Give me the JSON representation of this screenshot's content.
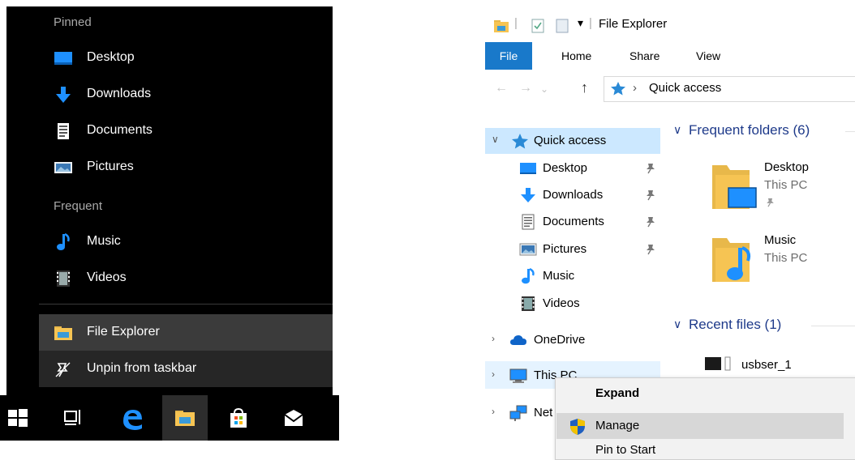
{
  "jumplist": {
    "pinned_header": "Pinned",
    "pinned": [
      {
        "label": "Desktop",
        "icon": "desktop-icon"
      },
      {
        "label": "Downloads",
        "icon": "downloads-icon"
      },
      {
        "label": "Documents",
        "icon": "documents-icon"
      },
      {
        "label": "Pictures",
        "icon": "pictures-icon"
      }
    ],
    "frequent_header": "Frequent",
    "frequent": [
      {
        "label": "Music",
        "icon": "music-icon"
      },
      {
        "label": "Videos",
        "icon": "videos-icon"
      }
    ],
    "app": {
      "label": "File Explorer",
      "icon": "folder-icon"
    },
    "unpin": {
      "label": "Unpin from taskbar",
      "icon": "unpin-icon"
    }
  },
  "taskbar": {
    "items": [
      "windows-start-icon",
      "task-view-icon",
      "edge-icon",
      "file-explorer-icon",
      "store-icon",
      "mail-icon"
    ]
  },
  "explorer": {
    "title": "File Explorer",
    "title_sep": "|",
    "ribbon_tabs": [
      "File",
      "Home",
      "Share",
      "View"
    ],
    "address": {
      "sep": "›",
      "location": "Quick access"
    },
    "nav": {
      "quick_access": "Quick access",
      "items": [
        {
          "label": "Desktop",
          "icon": "desktop-icon",
          "pinned": true
        },
        {
          "label": "Downloads",
          "icon": "downloads-icon",
          "pinned": true
        },
        {
          "label": "Documents",
          "icon": "documents-icon",
          "pinned": true
        },
        {
          "label": "Pictures",
          "icon": "pictures-icon",
          "pinned": true
        },
        {
          "label": "Music",
          "icon": "music-icon",
          "pinned": false
        },
        {
          "label": "Videos",
          "icon": "videos-icon",
          "pinned": false
        }
      ],
      "onedrive": "OneDrive",
      "thispc": "This PC",
      "network": "Net"
    },
    "frequent_folders": {
      "header": "Frequent folders (6)",
      "items": [
        {
          "name": "Desktop",
          "location": "This PC"
        },
        {
          "name": "Music",
          "location": "This PC"
        }
      ]
    },
    "recent_files": {
      "header": "Recent files (1)",
      "items": [
        {
          "name": "usbser_1"
        }
      ]
    }
  },
  "context_menu": {
    "items": [
      {
        "label": "Expand"
      },
      {
        "label": "Manage"
      },
      {
        "label": "Pin to Start"
      }
    ]
  },
  "colors": {
    "accent": "#1979ca",
    "selection": "#cce8ff",
    "link_header": "#1e3a8a"
  }
}
